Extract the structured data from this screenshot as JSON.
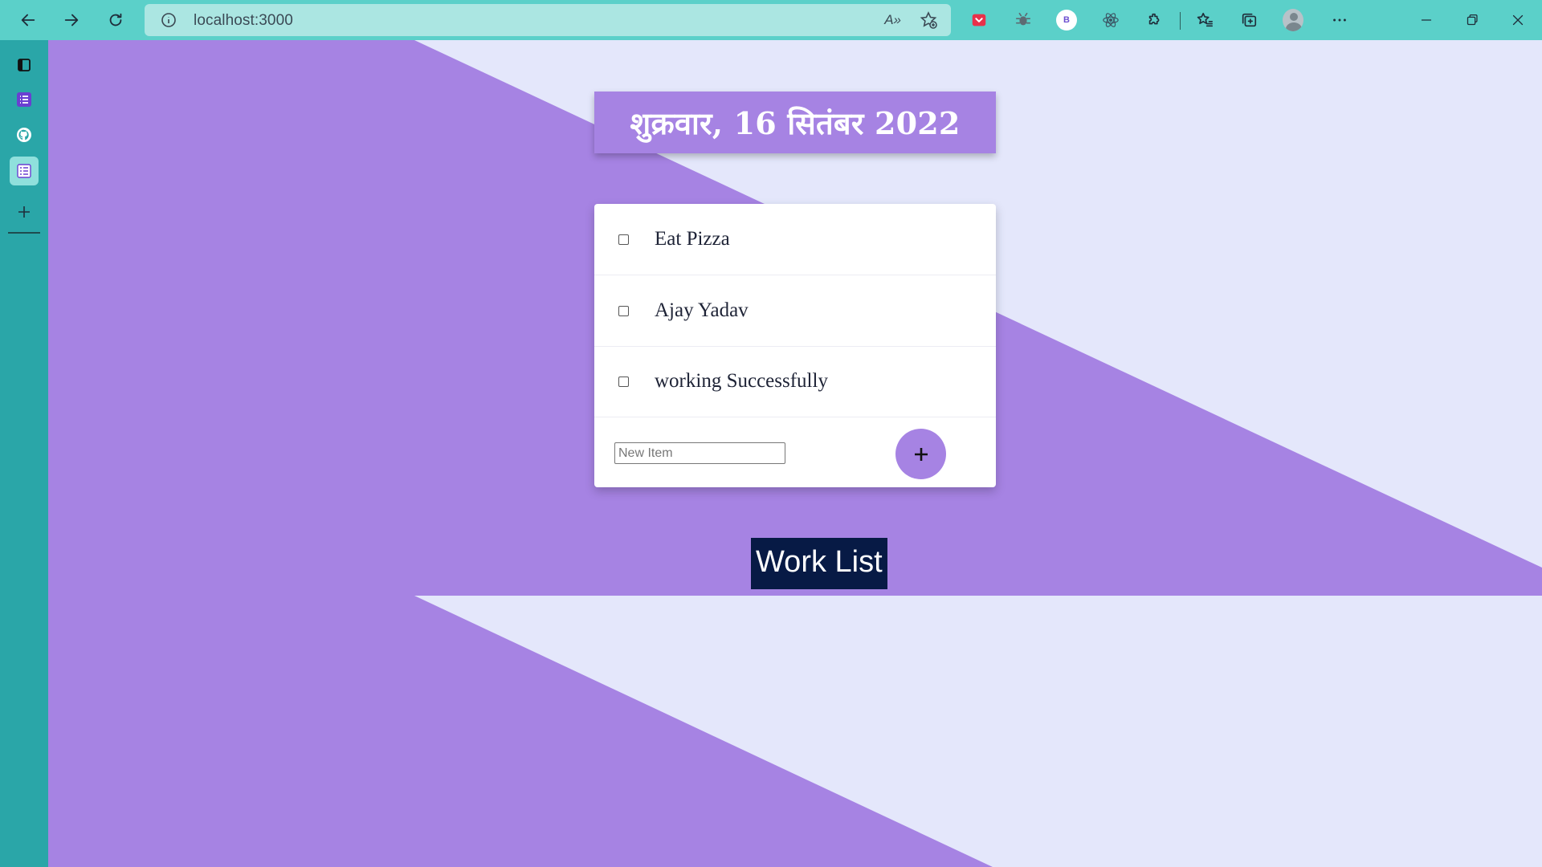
{
  "browser": {
    "url": "localhost:3000",
    "read_aloud_label": "A»",
    "extension_badge": "B",
    "icons": {
      "back": "back-arrow-icon",
      "forward": "forward-arrow-icon",
      "refresh": "refresh-icon",
      "info": "info-icon",
      "favorite_add": "star-plus-icon",
      "pocket": "pocket-icon",
      "bug": "bug-icon",
      "react": "react-icon",
      "extensions": "puzzle-icon",
      "favorites": "favorites-icon",
      "collections": "collections-icon",
      "profile": "profile-icon",
      "more": "more-icon",
      "minimize": "minimize-icon",
      "restore": "restore-icon",
      "close": "close-icon"
    }
  },
  "sidebar": {
    "icons": [
      "tabs-icon",
      "list-app-icon",
      "github-icon",
      "todo-app-icon",
      "add-icon"
    ]
  },
  "header": {
    "date": "शुक्रवार, 16 सितंबर 2022"
  },
  "todo": {
    "items": [
      {
        "text": "Eat Pizza",
        "checked": false
      },
      {
        "text": "Ajay Yadav",
        "checked": false
      },
      {
        "text": "working Successfully",
        "checked": false
      }
    ],
    "new_item_placeholder": "New Item",
    "new_item_value": "",
    "add_button_icon": "plus-icon"
  },
  "footer": {
    "work_list_label": "Work List"
  },
  "colors": {
    "topbar": "#5bd0c9",
    "address_bar": "#abe6e2",
    "sidebar": "#2aa6a8",
    "purple": "#a683e3",
    "light_bg": "#e4e7fb",
    "work_list_bg": "#071a45"
  }
}
